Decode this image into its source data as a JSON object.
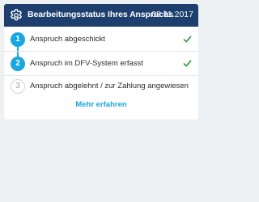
{
  "header": {
    "title": "Bearbeitungsstatus Ihres Anspruchs",
    "date": "08.11.2017",
    "icon": "gear-icon",
    "background": "#1c3f6e"
  },
  "steps": [
    {
      "number": "1",
      "label": "Anspruch abgeschickt",
      "completed": true
    },
    {
      "number": "2",
      "label": "Anspruch im DFV-System erfasst",
      "completed": true
    },
    {
      "number": "3",
      "label": "Anspruch abgelehnt / zur Zahlung angewiesen",
      "completed": false
    }
  ],
  "link": {
    "label": "Mehr erfahren"
  },
  "colors": {
    "accent": "#1aa6df",
    "check": "#2e9c4a"
  }
}
